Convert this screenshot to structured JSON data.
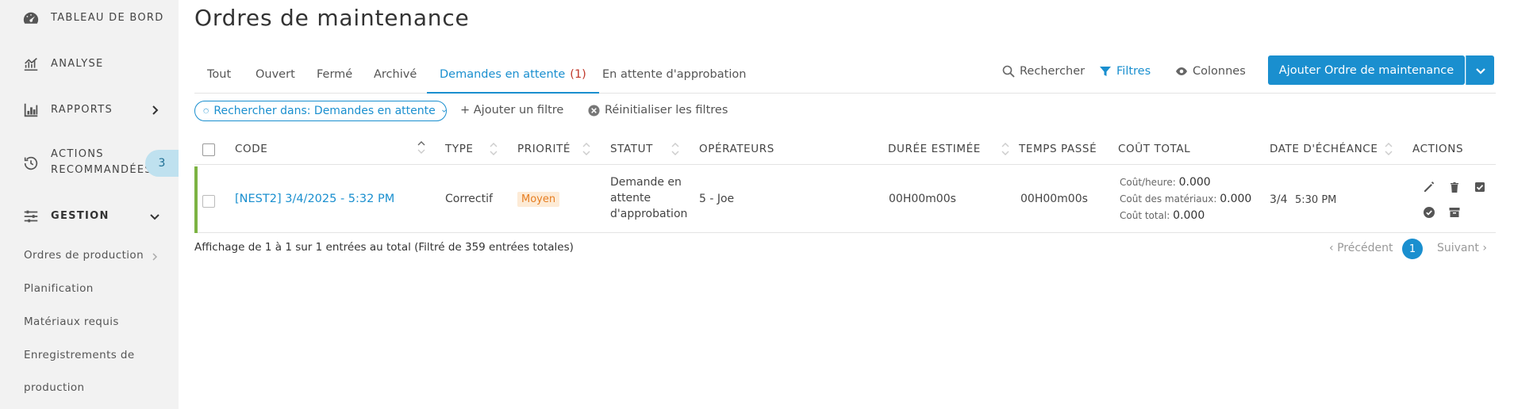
{
  "sidebar": {
    "items": [
      {
        "label": "TABLEAU DE BORD",
        "icon": "speedometer-icon"
      },
      {
        "label": "ANALYSE",
        "icon": "chart-line-icon"
      },
      {
        "label": "RAPPORTS",
        "icon": "bar-chart-icon"
      },
      {
        "label_line1": "ACTIONS",
        "label_line2": "RECOMMANDÉES",
        "badge": "3",
        "icon": "history-icon"
      },
      {
        "label": "GESTION",
        "icon": "sliders-icon"
      }
    ],
    "sub_items": [
      "Ordres de production",
      "Planification",
      "Matériaux requis",
      "Enregistrements de",
      "production"
    ]
  },
  "page": {
    "title": "Ordres de maintenance"
  },
  "tabs": [
    {
      "label": "Tout"
    },
    {
      "label": "Ouvert"
    },
    {
      "label": "Fermé"
    },
    {
      "label": "Archivé"
    },
    {
      "label": "Demandes en attente",
      "count": "(1)",
      "active": true
    },
    {
      "label": "En attente d'approbation"
    }
  ],
  "toolbar": {
    "search": "Rechercher",
    "filters": "Filtres",
    "columns": "Colonnes",
    "add_button": "Ajouter Ordre de maintenance"
  },
  "filters": {
    "chip": "Rechercher dans: Demandes en attente",
    "add_filter": "+ Ajouter un filtre",
    "reset": "Réinitialiser les filtres"
  },
  "table": {
    "headers": [
      "CODE",
      "TYPE",
      "PRIORITÉ",
      "STATUT",
      "OPÉRATEURS",
      "DURÉE ESTIMÉE",
      "TEMPS PASSÉ",
      "COÛT TOTAL",
      "DATE D'ÉCHÉANCE",
      "ACTIONS"
    ],
    "rows": [
      {
        "code": "[NEST2] 3/4/2025 - 5:32 PM",
        "type": "Correctif",
        "priority": "Moyen",
        "status_line1": "Demande en",
        "status_line2": "attente",
        "status_line3": "d'approbation",
        "operators": "5 - Joe",
        "estimated_duration": "00H00m00s",
        "time_spent": "00H00m00s",
        "cost_hour_label": "Coût/heure:",
        "cost_hour": "0.000",
        "cost_materials_label": "Coût des matériaux:",
        "cost_materials": "0.000",
        "cost_total_label": "Coût total:",
        "cost_total": "0.000",
        "due_date": "3/4",
        "due_time": "5:30 PM"
      }
    ]
  },
  "footer": {
    "summary": "Affichage de 1 à 1 sur 1 entrées au total (Filtré de 359 entrées totales)",
    "prev": "Précédent",
    "page": "1",
    "next": "Suivant"
  },
  "colors": {
    "accent": "#1a8fcf",
    "sidebar_bg": "#f2f2f2",
    "row_marker": "#7cb342",
    "priority_bg": "#fdebd6",
    "priority_text": "#e67e22",
    "tab_count": "#c0392b"
  }
}
